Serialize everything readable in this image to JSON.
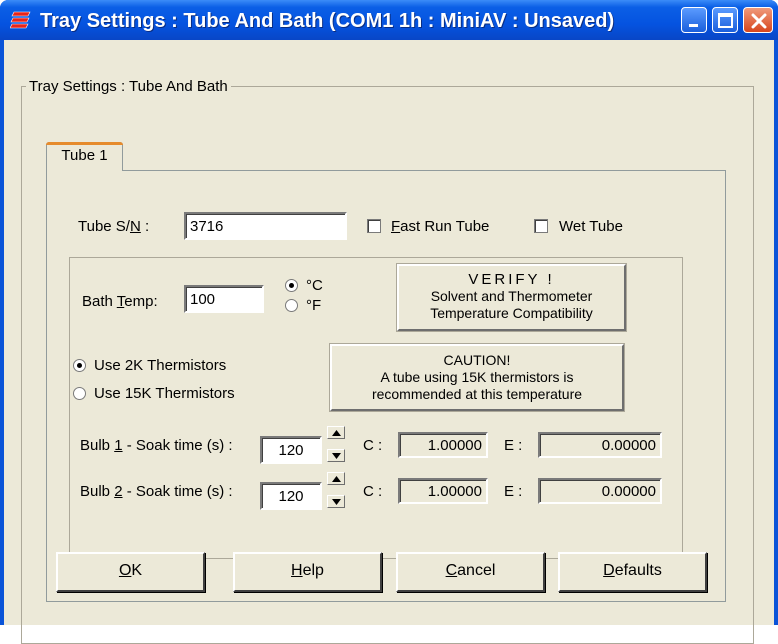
{
  "window": {
    "title": "Tray Settings : Tube And Bath (COM1 1h : MiniAV : Unsaved)",
    "icon": "app-icon",
    "controls": [
      "minimize-icon",
      "maximize-icon",
      "close-icon"
    ]
  },
  "group": {
    "label": "Tray Settings : Tube And Bath"
  },
  "tabs": [
    {
      "label": "Tube 1",
      "selected": true
    }
  ],
  "tube": {
    "serial_label_pre": "Tube S/",
    "serial_label_mnemonic": "N",
    "serial_label_post": " :",
    "serial_value": "3716",
    "fast_run": {
      "mnemonic": "F",
      "label_rest": "ast Run Tube",
      "checked": false
    },
    "wet_tube": {
      "label": "Wet Tube",
      "checked": false
    }
  },
  "bath": {
    "temp_label_pre": "Bath ",
    "temp_label_mnemonic": "T",
    "temp_label_post": "emp:",
    "temp_value": "100",
    "unit_c": {
      "label": "°C",
      "selected": true
    },
    "unit_f": {
      "label": "°F",
      "selected": false
    },
    "verify": {
      "title": "VERIFY !",
      "line1": "Solvent and Thermometer",
      "line2": "Temperature Compatibility"
    },
    "thermistor_2k": {
      "label": "Use 2K Thermistors",
      "selected": true
    },
    "thermistor_15k": {
      "label": "Use 15K Thermistors",
      "selected": false
    },
    "caution": {
      "title": "CAUTION!",
      "line1": "A tube using 15K thermistors is",
      "line2": "recommended at this temperature"
    }
  },
  "bulbs": [
    {
      "label_pre": "Bulb ",
      "mnemonic": "1",
      "label_post": " - Soak time (s) :",
      "soak": "120",
      "c_label": "C :",
      "c_value": "1.00000",
      "e_label": "E :",
      "e_value": "0.00000"
    },
    {
      "label_pre": "Bulb ",
      "mnemonic": "2",
      "label_post": " - Soak time (s) :",
      "soak": "120",
      "c_label": "C :",
      "c_value": "1.00000",
      "e_label": "E :",
      "e_value": "0.00000"
    }
  ],
  "buttons": {
    "ok_mnemonic": "O",
    "ok_rest": "K",
    "help_mnemonic": "H",
    "help_rest": "elp",
    "cancel_mnemonic": "C",
    "cancel_rest": "ancel",
    "defaults_mnemonic": "D",
    "defaults_rest": "efaults"
  },
  "colors": {
    "titlebar": "#0553e0",
    "dialog_background": "#ece9d8",
    "close_button": "#d8461d",
    "tab_highlight": "#e68b2c"
  }
}
